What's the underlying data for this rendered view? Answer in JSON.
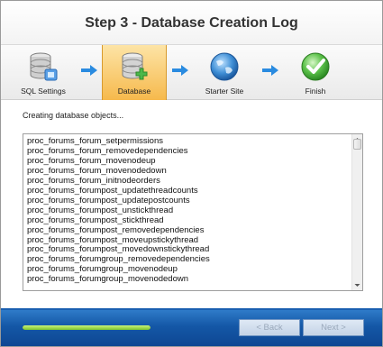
{
  "header": {
    "title": "Step 3 - Database Creation Log"
  },
  "steps": [
    {
      "label": "SQL Settings",
      "icon": "database-server-icon",
      "active": false
    },
    {
      "label": "Database",
      "icon": "database-add-icon",
      "active": true
    },
    {
      "label": "Starter Site",
      "icon": "globe-icon",
      "active": false
    },
    {
      "label": "Finish",
      "icon": "checkmark-icon",
      "active": false
    }
  ],
  "content": {
    "status": "Creating database objects...",
    "log_lines": [
      "proc_forums_forum_setpermissions",
      "proc_forums_forum_removedependencies",
      "proc_forums_forum_movenodeup",
      "proc_forums_forum_movenodedown",
      "proc_forums_forum_initnodeorders",
      "proc_forums_forumpost_updatethreadcounts",
      "proc_forums_forumpost_updatepostcounts",
      "proc_forums_forumpost_unstickthread",
      "proc_forums_forumpost_stickthread",
      "proc_forums_forumpost_removedependencies",
      "proc_forums_forumpost_moveupstickythread",
      "proc_forums_forumpost_movedownstickythread",
      "proc_forums_forumgroup_removedependencies",
      "proc_forums_forumgroup_movenodeup",
      "proc_forums_forumgroup_movenodedown"
    ]
  },
  "footer": {
    "progress_fraction": 1.0,
    "back_label": "< Back",
    "next_label": "Next >"
  },
  "colors": {
    "accent_active_step": "#f6b94c",
    "footer_blue": "#1457a6",
    "arrow_blue": "#2a8be0",
    "progress_green": "#8fd23a"
  }
}
